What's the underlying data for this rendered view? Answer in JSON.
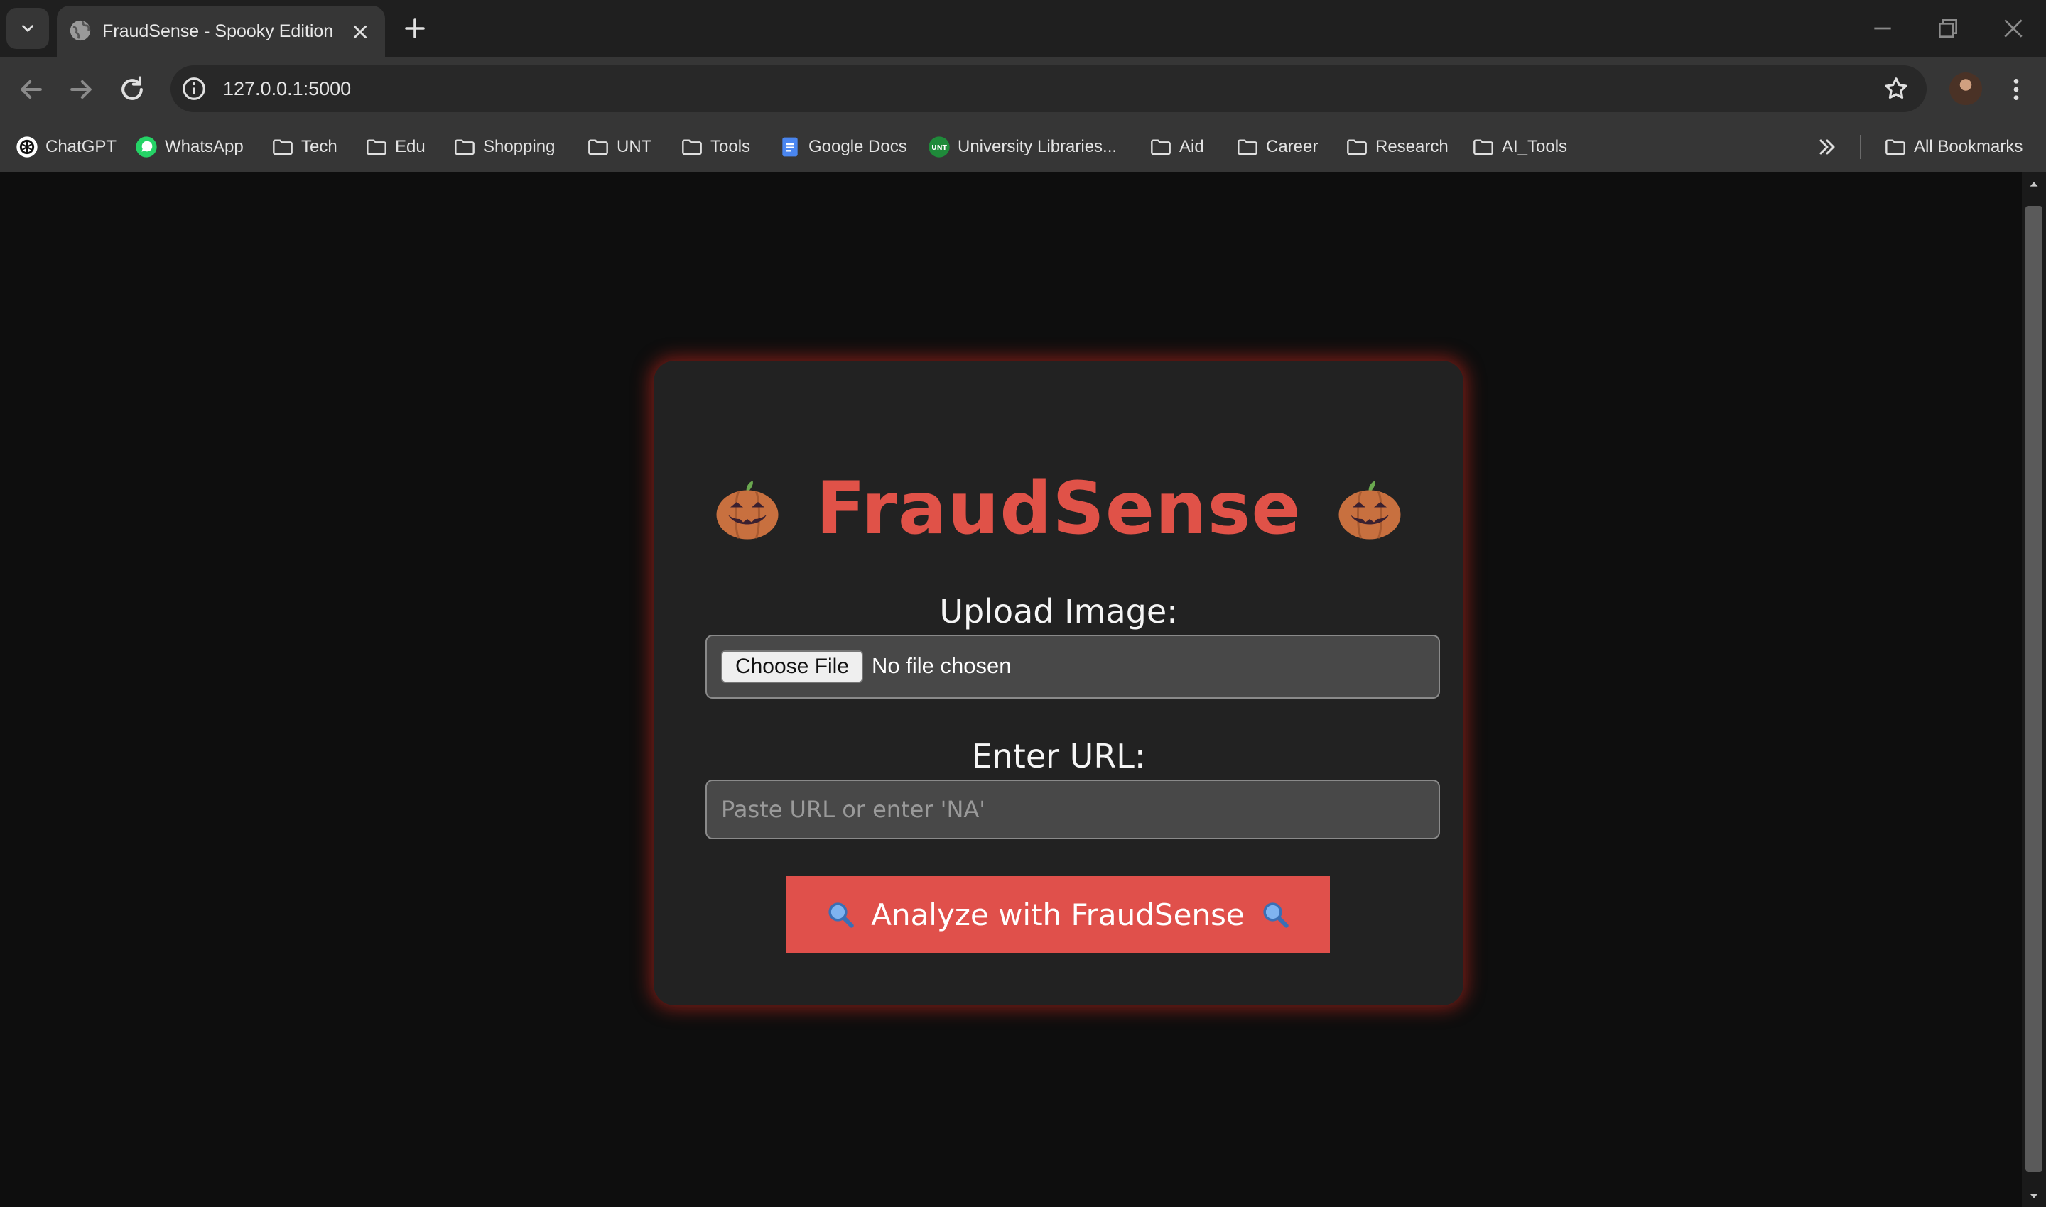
{
  "browser": {
    "tab_title": "FraudSense - Spooky Edition",
    "url": "127.0.0.1:5000",
    "bookmarks": [
      {
        "label": "ChatGPT",
        "icon": "chatgpt-icon"
      },
      {
        "label": "WhatsApp",
        "icon": "whatsapp-icon"
      },
      {
        "label": "Tech",
        "icon": "folder-icon"
      },
      {
        "label": "Edu",
        "icon": "folder-icon"
      },
      {
        "label": "Shopping",
        "icon": "folder-icon"
      },
      {
        "label": "UNT",
        "icon": "folder-icon"
      },
      {
        "label": "Tools",
        "icon": "folder-icon"
      },
      {
        "label": "Google Docs",
        "icon": "google-docs-icon"
      },
      {
        "label": "University Libraries...",
        "icon": "unt-icon"
      },
      {
        "label": "Aid",
        "icon": "folder-icon"
      },
      {
        "label": "Career",
        "icon": "folder-icon"
      },
      {
        "label": "Research",
        "icon": "folder-icon"
      },
      {
        "label": "AI_Tools",
        "icon": "folder-icon"
      }
    ],
    "all_bookmarks_label": "All Bookmarks"
  },
  "app": {
    "title": "FraudSense",
    "upload_label": "Upload Image:",
    "choose_file_label": "Choose File",
    "no_file_text": "No file chosen",
    "url_label": "Enter URL:",
    "url_placeholder": "Paste URL or enter 'NA'",
    "url_value": "",
    "analyze_label": "Analyze with FraudSense"
  },
  "colors": {
    "accent": "#e0504b",
    "title": "#e05248",
    "card": "#222222",
    "background": "#0e0e0e"
  }
}
